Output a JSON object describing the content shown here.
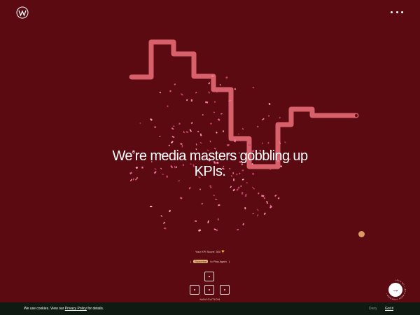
{
  "header": {
    "logo_icon": "w-logo-icon",
    "menu_icon": "more-dots-icon"
  },
  "main": {
    "headline": "We’re media masters gobbling up KPIs."
  },
  "game": {
    "score_text": "Your KPI Score: 300 🏆",
    "hint_key": "Spacebar",
    "hint_text": "to Play Again",
    "nav_label": "NAVIGATION",
    "keys": [
      "up-key",
      "left-key",
      "down-key",
      "right-key"
    ],
    "snake_color": "#d8606a",
    "confetti_colors": [
      "#e05a8a",
      "#f07aa0",
      "#c83f6e",
      "#ff9dbb"
    ]
  },
  "cta": {
    "ring_text": "LET'S GO • LET'S WORK TOGETHER •",
    "arrow_icon": "arrow-right-icon"
  },
  "cookie": {
    "text_before": "We use cookies. View our ",
    "link_text": "Privacy Policy",
    "text_after": " for details.",
    "deny_label": "Deny",
    "accept_label": "Got it"
  }
}
